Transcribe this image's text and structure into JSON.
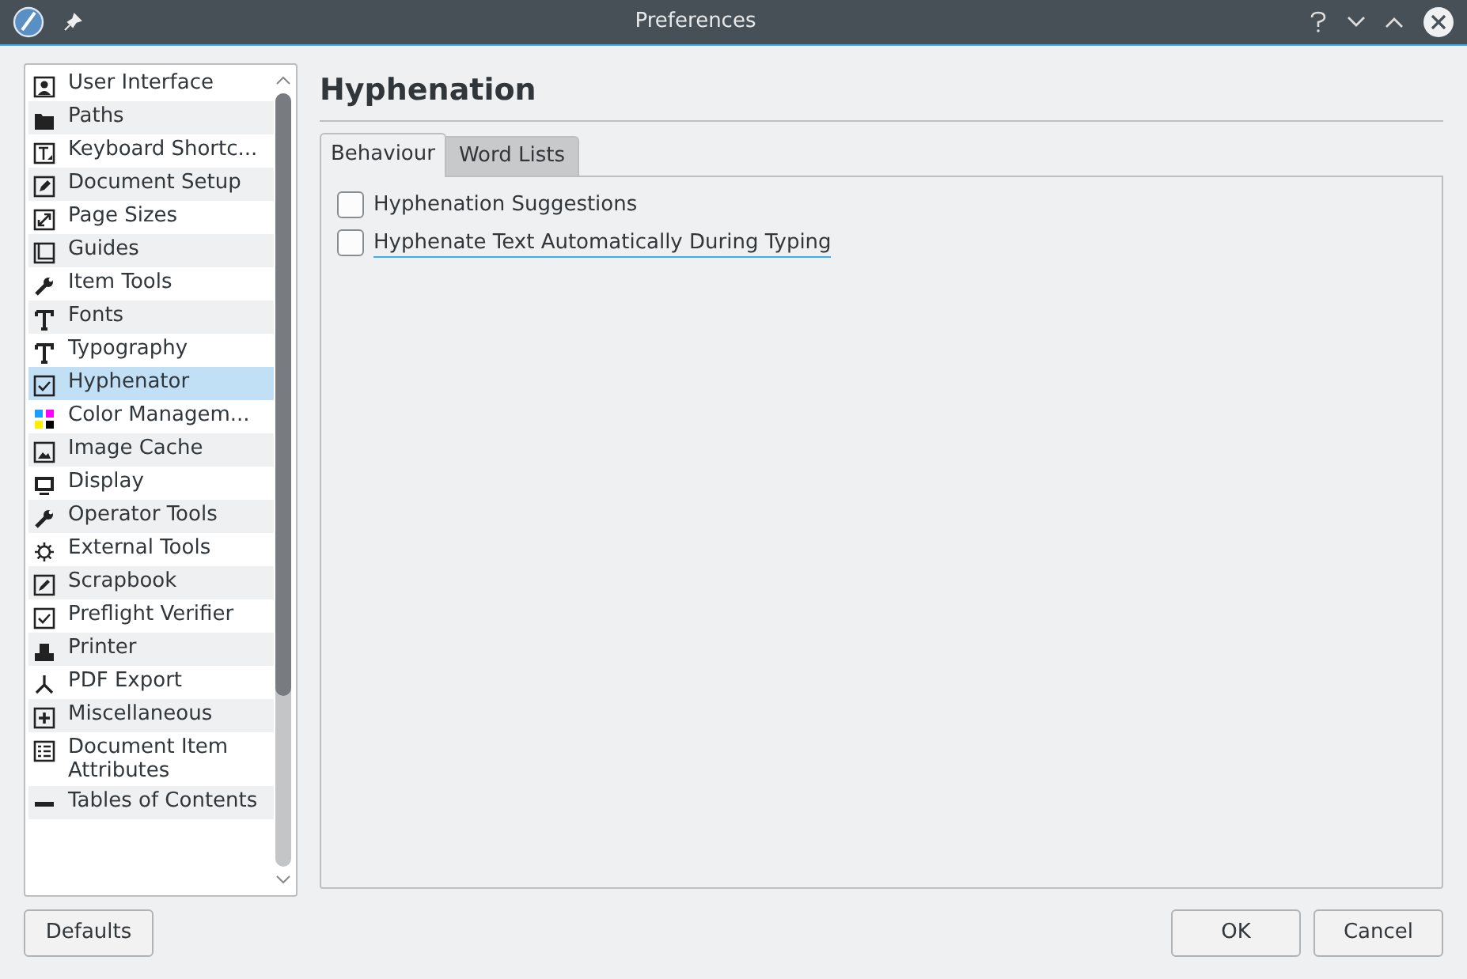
{
  "window": {
    "title": "Preferences"
  },
  "sidebar": {
    "items": [
      {
        "label": "User Interface",
        "selected": false
      },
      {
        "label": "Paths",
        "selected": false
      },
      {
        "label": "Keyboard Shortc...",
        "selected": false
      },
      {
        "label": "Document Setup",
        "selected": false
      },
      {
        "label": "Page Sizes",
        "selected": false
      },
      {
        "label": "Guides",
        "selected": false
      },
      {
        "label": "Item Tools",
        "selected": false
      },
      {
        "label": "Fonts",
        "selected": false
      },
      {
        "label": "Typography",
        "selected": false
      },
      {
        "label": "Hyphenator",
        "selected": true
      },
      {
        "label": "Color Managem...",
        "selected": false
      },
      {
        "label": "Image Cache",
        "selected": false
      },
      {
        "label": "Display",
        "selected": false
      },
      {
        "label": "Operator Tools",
        "selected": false
      },
      {
        "label": "External Tools",
        "selected": false
      },
      {
        "label": "Scrapbook",
        "selected": false
      },
      {
        "label": "Preflight Verifier",
        "selected": false
      },
      {
        "label": "Printer",
        "selected": false
      },
      {
        "label": "PDF Export",
        "selected": false
      },
      {
        "label": "Miscellaneous",
        "selected": false
      },
      {
        "label": "Document Item Attributes",
        "selected": false
      },
      {
        "label": "Tables of Contents",
        "selected": false
      }
    ]
  },
  "page": {
    "heading": "Hyphenation",
    "tabs": [
      {
        "label": "Behaviour",
        "selected": true
      },
      {
        "label": "Word Lists",
        "selected": false
      }
    ],
    "options": [
      {
        "label": "Hyphenation Suggestions",
        "checked": false,
        "focused": false
      },
      {
        "label": "Hyphenate Text Automatically During Typing",
        "checked": false,
        "focused": true
      }
    ]
  },
  "buttons": {
    "defaults": "Defaults",
    "ok": "OK",
    "cancel": "Cancel"
  }
}
